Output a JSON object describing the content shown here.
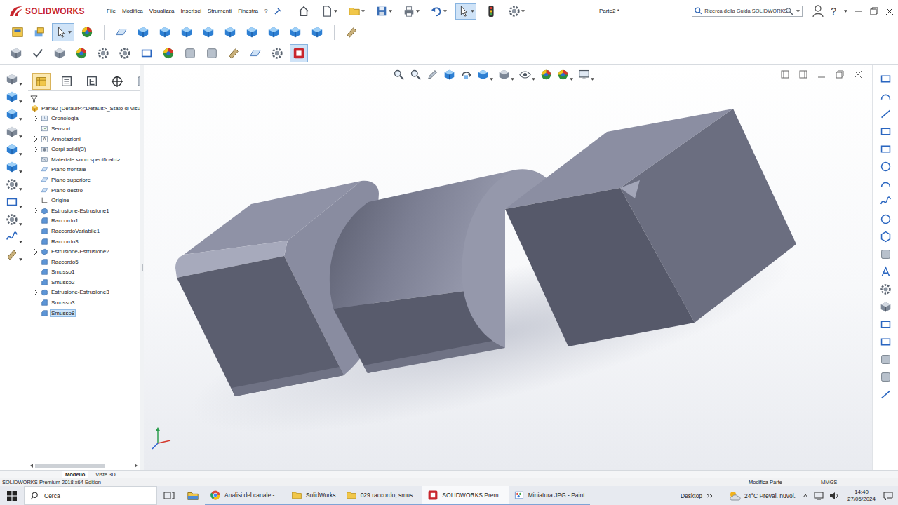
{
  "app": {
    "logo": "SOLIDWORKS",
    "document": "Parte2 *",
    "search_placeholder": "Ricerca della Guida SOLIDWORKS",
    "help_button": "?"
  },
  "menu": [
    "File",
    "Modifica",
    "Visualizza",
    "Inserisci",
    "Strumenti",
    "Finestra",
    "?"
  ],
  "toolbar_states": {
    "quick_select_active": true,
    "select_tool_active": true,
    "addins_active": true
  },
  "panel_tabs_selected": [
    true,
    false,
    false,
    false,
    false
  ],
  "tree": [
    {
      "label": "Parte2  (Default<<Default>_Stato di visu",
      "kind": "part",
      "expandable": false,
      "expanded": false,
      "selected": false
    },
    {
      "label": "Cronologia",
      "kind": "history",
      "expandable": true,
      "expanded": false,
      "selected": false
    },
    {
      "label": "Sensori",
      "kind": "sensor",
      "expandable": false,
      "expanded": false,
      "selected": false
    },
    {
      "label": "Annotazioni",
      "kind": "annotation",
      "expandable": true,
      "expanded": false,
      "selected": false
    },
    {
      "label": "Corpi solidi(3)",
      "kind": "bodies",
      "expandable": true,
      "expanded": false,
      "selected": false
    },
    {
      "label": "Materiale <non specificato>",
      "kind": "material",
      "expandable": false,
      "expanded": false,
      "selected": false
    },
    {
      "label": "Piano frontale",
      "kind": "plane",
      "expandable": false,
      "expanded": false,
      "selected": false
    },
    {
      "label": "Piano superiore",
      "kind": "plane",
      "expandable": false,
      "expanded": false,
      "selected": false
    },
    {
      "label": "Piano destro",
      "kind": "plane",
      "expandable": false,
      "expanded": false,
      "selected": false
    },
    {
      "label": "Origine",
      "kind": "origin",
      "expandable": false,
      "expanded": false,
      "selected": false
    },
    {
      "label": "Estrusione-Estrusione1",
      "kind": "extrude",
      "expandable": true,
      "expanded": false,
      "selected": false
    },
    {
      "label": "Raccordo1",
      "kind": "fillet",
      "expandable": false,
      "expanded": false,
      "selected": false
    },
    {
      "label": "RaccordoVariabile1",
      "kind": "fillet",
      "expandable": false,
      "expanded": false,
      "selected": false
    },
    {
      "label": "Raccordo3",
      "kind": "fillet",
      "expandable": false,
      "expanded": false,
      "selected": false
    },
    {
      "label": "Estrusione-Estrusione2",
      "kind": "extrude",
      "expandable": true,
      "expanded": false,
      "selected": false
    },
    {
      "label": "Raccordo5",
      "kind": "fillet",
      "expandable": false,
      "expanded": false,
      "selected": false
    },
    {
      "label": "Smusso1",
      "kind": "chamfer",
      "expandable": false,
      "expanded": false,
      "selected": false
    },
    {
      "label": "Smusso2",
      "kind": "chamfer",
      "expandable": false,
      "expanded": false,
      "selected": false
    },
    {
      "label": "Estrusione-Estrusione3",
      "kind": "extrude",
      "expandable": true,
      "expanded": false,
      "selected": false
    },
    {
      "label": "Smusso3",
      "kind": "chamfer",
      "expandable": false,
      "expanded": false,
      "selected": false
    },
    {
      "label": "Smusso8",
      "kind": "chamfer",
      "expandable": false,
      "expanded": false,
      "selected": true
    }
  ],
  "bottom_tabs": [
    {
      "label": "Modello",
      "selected": true
    },
    {
      "label": "Viste 3D",
      "selected": false
    }
  ],
  "status_bar": {
    "edition": "SOLIDWORKS Premium 2018 x64 Edition",
    "mode": "Modifica Parte",
    "units": "MMGS"
  },
  "taskbar": {
    "search": "Cerca",
    "apps": [
      {
        "label": "Analisi del canale - ...",
        "kind": "chrome",
        "selected": false
      },
      {
        "label": "SolidWorks",
        "kind": "folder",
        "selected": false
      },
      {
        "label": "029 raccordo, smus...",
        "kind": "folder",
        "selected": false
      },
      {
        "label": "SOLIDWORKS Prem...",
        "kind": "solidworks",
        "selected": true
      },
      {
        "label": "Miniatura.JPG - Paint",
        "kind": "paint",
        "selected": false
      }
    ],
    "desktop": "Desktop",
    "weather": "24°C  Preval. nuvol.",
    "time": "14:40",
    "date": "27/05/2024"
  }
}
